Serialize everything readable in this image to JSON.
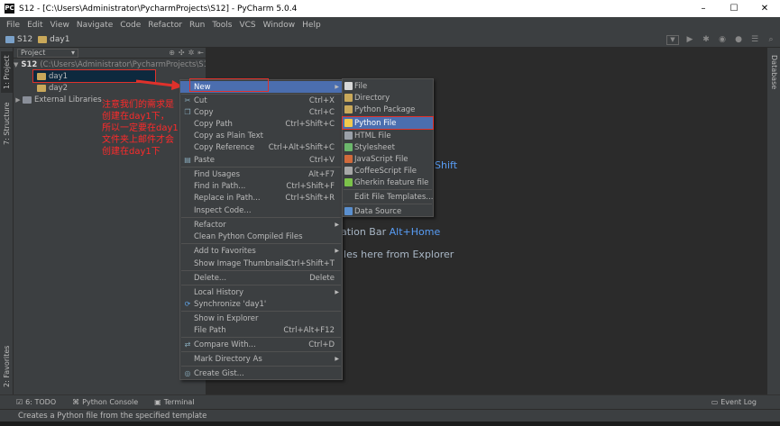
{
  "window": {
    "title": "S12 - [C:\\Users\\Administrator\\PycharmProjects\\S12] - PyCharm 5.0.4",
    "controls": [
      "–",
      "☐",
      "✕"
    ]
  },
  "menu": [
    "File",
    "Edit",
    "View",
    "Navigate",
    "Code",
    "Refactor",
    "Run",
    "Tools",
    "VCS",
    "Window",
    "Help"
  ],
  "breadcrumb": {
    "project": "S12",
    "folder": "day1"
  },
  "left_tool_tabs": {
    "project": "1: Project",
    "structure": "7: Structure",
    "favorites": "2: Favorites"
  },
  "right_tool_tabs": {
    "database": "Database"
  },
  "project_panel": {
    "selector": "Project",
    "tree": {
      "root": "S12",
      "root_path": "(C:\\Users\\Administrator\\PycharmProjects\\S12)",
      "day1": "day1",
      "day2": "day2",
      "external": "External Libraries"
    }
  },
  "editor_hints": {
    "shift_text": "Shift",
    "nav_text": "ation Bar",
    "nav_key": "Alt+Home",
    "explorer_text": "iles here from Explorer"
  },
  "context_menu": {
    "new": "New",
    "cut": {
      "label": "Cut",
      "shortcut": "Ctrl+X"
    },
    "copy": {
      "label": "Copy",
      "shortcut": "Ctrl+C"
    },
    "copy_path": {
      "label": "Copy Path",
      "shortcut": "Ctrl+Shift+C"
    },
    "copy_plain": {
      "label": "Copy as Plain Text"
    },
    "copy_ref": {
      "label": "Copy Reference",
      "shortcut": "Ctrl+Alt+Shift+C"
    },
    "paste": {
      "label": "Paste",
      "shortcut": "Ctrl+V"
    },
    "find_usages": {
      "label": "Find Usages",
      "shortcut": "Alt+F7"
    },
    "find_in_path": {
      "label": "Find in Path...",
      "shortcut": "Ctrl+Shift+F"
    },
    "replace_in_path": {
      "label": "Replace in Path...",
      "shortcut": "Ctrl+Shift+R"
    },
    "inspect_code": {
      "label": "Inspect Code..."
    },
    "refactor": {
      "label": "Refactor"
    },
    "clean_python": {
      "label": "Clean Python Compiled Files"
    },
    "add_favorites": {
      "label": "Add to Favorites"
    },
    "show_thumbnails": {
      "label": "Show Image Thumbnails",
      "shortcut": "Ctrl+Shift+T"
    },
    "delete": {
      "label": "Delete...",
      "shortcut": "Delete"
    },
    "local_history": {
      "label": "Local History"
    },
    "synchronize": {
      "label": "Synchronize 'day1'"
    },
    "show_explorer": {
      "label": "Show in Explorer"
    },
    "file_path": {
      "label": "File Path",
      "shortcut": "Ctrl+Alt+F12"
    },
    "compare_with": {
      "label": "Compare With...",
      "shortcut": "Ctrl+D"
    },
    "mark_directory": {
      "label": "Mark Directory As"
    },
    "create_gist": {
      "label": "Create Gist..."
    }
  },
  "new_submenu": {
    "file": "File",
    "directory": "Directory",
    "python_package": "Python Package",
    "python_file": "Python File",
    "html_file": "HTML File",
    "stylesheet": "Stylesheet",
    "javascript_file": "JavaScript File",
    "coffeescript_file": "CoffeeScript File",
    "gherkin_file": "Gherkin feature file",
    "edit_templates": "Edit File Templates...",
    "data_source": "Data Source"
  },
  "annotation": {
    "line1": "注意我们的需求是",
    "line2": "创建在day1下，",
    "line3": "所以一定要在day1",
    "line4": "文件夹上邮件才会",
    "line5": "创建在day1下"
  },
  "bottom_tools": {
    "todo": "6: TODO",
    "console": "Python Console",
    "terminal": "Terminal",
    "event_log": "Event Log"
  },
  "status": {
    "message": "Creates a Python file from the specified template"
  },
  "colors": {
    "highlight": "#4b6eaf",
    "annotation": "#ff2a2a",
    "key": "#589df6"
  }
}
